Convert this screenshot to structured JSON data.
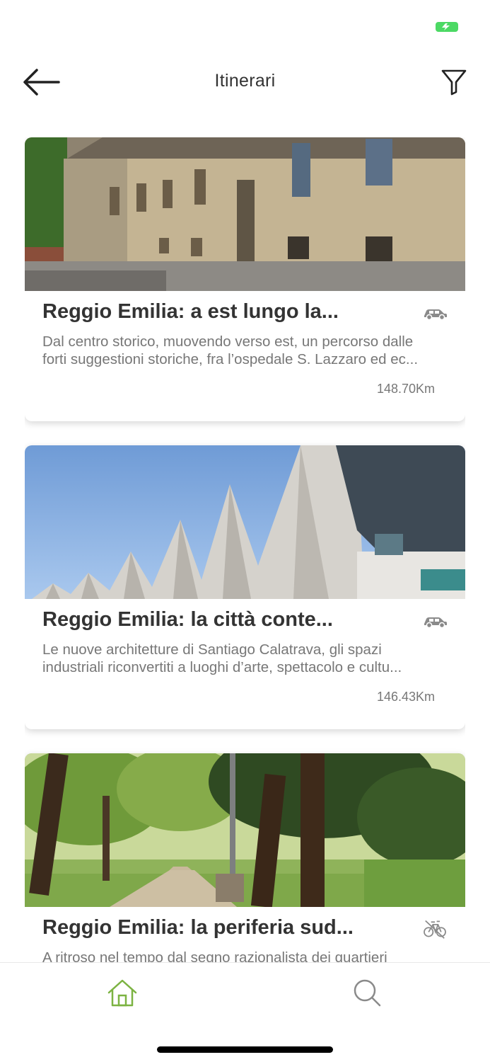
{
  "header": {
    "title": "Itinerari",
    "back_icon": "arrow-left-icon",
    "filter_icon": "filter-funnel-icon"
  },
  "status_bar": {
    "battery_icon": "battery-charging-icon",
    "battery_color": "#4cd964"
  },
  "itineraries": [
    {
      "title": "Reggio Emilia: a est lungo la...",
      "description_lines": [
        "Dal centro storico, muovendo verso est, un percorso dalle",
        "forti suggestioni storiche, fra l’ospedale S. Lazzaro ed ec..."
      ],
      "distance": "148.70Km",
      "mode_icon": "car-icon",
      "image": "historic-building-photo"
    },
    {
      "title": "Reggio Emilia: la città conte...",
      "description_lines": [
        "Le nuove architetture di Santiago Calatrava, gli spazi",
        "industriali riconvertiti a luoghi d’arte, spettacolo e cultu..."
      ],
      "distance": "146.43Km",
      "mode_icon": "car-icon",
      "image": "calatrava-station-photo"
    },
    {
      "title": "Reggio Emilia: la periferia sud...",
      "description_lines": [
        "A ritroso nel tempo dal segno razionalista dei quartieri"
      ],
      "distance": "",
      "mode_icon": "bicycle-icon",
      "image": "tree-lined-park-photo"
    }
  ],
  "tab_bar": {
    "home_icon": "home-icon",
    "search_icon": "search-icon",
    "active_color": "#7cb342",
    "inactive_color": "#8a8a8a"
  }
}
